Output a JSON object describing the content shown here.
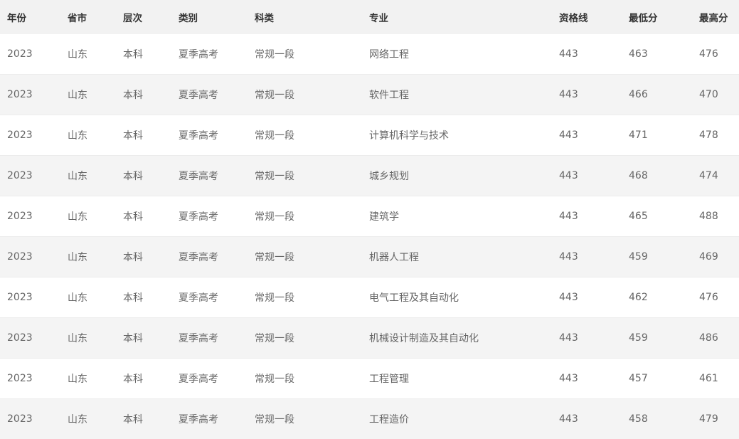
{
  "table": {
    "headers": [
      "年份",
      "省市",
      "层次",
      "类别",
      "科类",
      "专业",
      "资格线",
      "最低分",
      "最高分"
    ],
    "rows": [
      [
        "2023",
        "山东",
        "本科",
        "夏季高考",
        "常规一段",
        "网络工程",
        "443",
        "463",
        "476"
      ],
      [
        "2023",
        "山东",
        "本科",
        "夏季高考",
        "常规一段",
        "软件工程",
        "443",
        "466",
        "470"
      ],
      [
        "2023",
        "山东",
        "本科",
        "夏季高考",
        "常规一段",
        "计算机科学与技术",
        "443",
        "471",
        "478"
      ],
      [
        "2023",
        "山东",
        "本科",
        "夏季高考",
        "常规一段",
        "城乡规划",
        "443",
        "468",
        "474"
      ],
      [
        "2023",
        "山东",
        "本科",
        "夏季高考",
        "常规一段",
        "建筑学",
        "443",
        "465",
        "488"
      ],
      [
        "2023",
        "山东",
        "本科",
        "夏季高考",
        "常规一段",
        "机器人工程",
        "443",
        "459",
        "469"
      ],
      [
        "2023",
        "山东",
        "本科",
        "夏季高考",
        "常规一段",
        "电气工程及其自动化",
        "443",
        "462",
        "476"
      ],
      [
        "2023",
        "山东",
        "本科",
        "夏季高考",
        "常规一段",
        "机械设计制造及其自动化",
        "443",
        "459",
        "486"
      ],
      [
        "2023",
        "山东",
        "本科",
        "夏季高考",
        "常规一段",
        "工程管理",
        "443",
        "457",
        "461"
      ],
      [
        "2023",
        "山东",
        "本科",
        "夏季高考",
        "常规一段",
        "工程造价",
        "443",
        "458",
        "479"
      ]
    ]
  }
}
